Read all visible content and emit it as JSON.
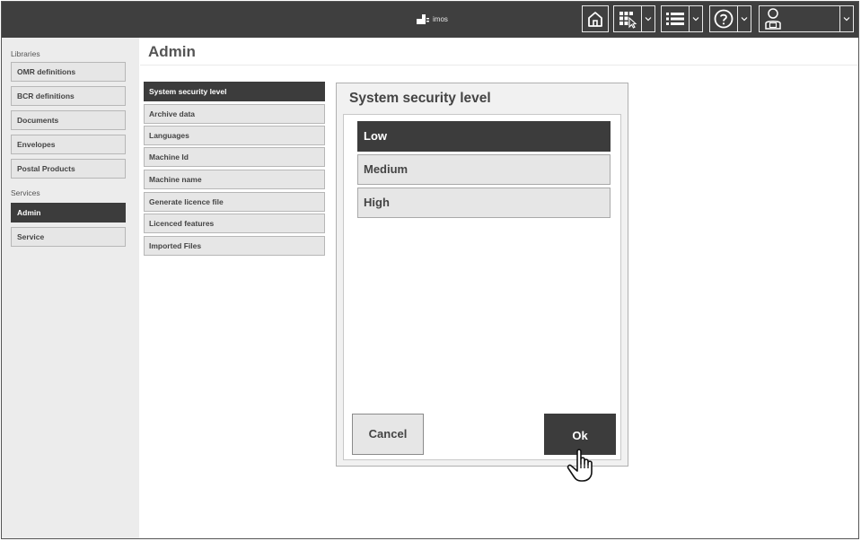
{
  "header": {
    "logo_text": "imos",
    "icons": {
      "home": "home-icon",
      "grid": "grid-select-icon",
      "list": "list-icon",
      "help": "help-icon",
      "user": "user-badge-icon",
      "caret": "chevron-down-icon"
    }
  },
  "sidebar": {
    "libraries_label": "Libraries",
    "libraries": [
      "OMR definitions",
      "BCR definitions",
      "Documents",
      "Envelopes",
      "Postal Products"
    ],
    "services_label": "Services",
    "services": [
      "Admin",
      "Service"
    ],
    "active": "Admin"
  },
  "page": {
    "title": "Admin"
  },
  "admin_menu": {
    "items": [
      "System security level",
      "Archive data",
      "Languages",
      "Machine Id",
      "Machine name",
      "Generate licence file",
      "Licenced features",
      "Imported Files"
    ],
    "active": "System security level"
  },
  "dialog": {
    "title": "System security level",
    "options": [
      "Low",
      "Medium",
      "High"
    ],
    "selected": "Low",
    "cancel_label": "Cancel",
    "ok_label": "Ok"
  },
  "colors": {
    "topbar": "#3f3f3f",
    "active": "#3c3c3c",
    "item_bg": "#e6e6e6",
    "sidebar_bg": "#ececec"
  }
}
